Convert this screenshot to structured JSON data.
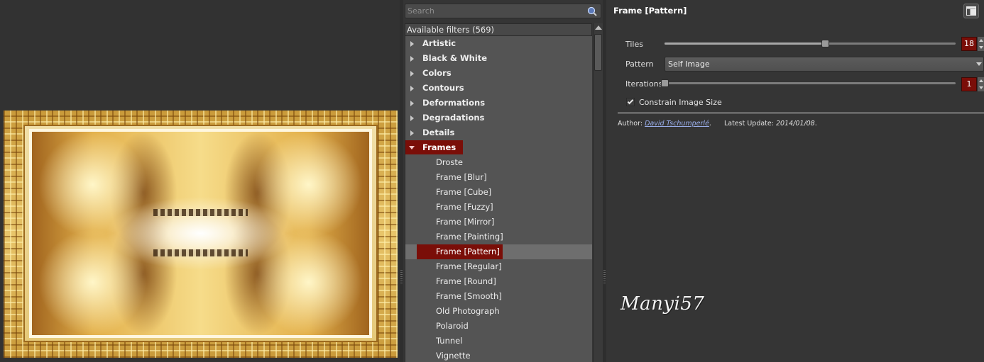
{
  "search": {
    "placeholder": "Search"
  },
  "filters": {
    "header": "Available filters (569)",
    "categories_before": [
      {
        "label": "Artistic"
      },
      {
        "label": "Black & White"
      },
      {
        "label": "Colors"
      },
      {
        "label": "Contours"
      },
      {
        "label": "Deformations"
      },
      {
        "label": "Degradations"
      },
      {
        "label": "Details"
      }
    ],
    "open_category": {
      "label": "Frames"
    },
    "sub_items": [
      {
        "label": "Droste"
      },
      {
        "label": "Frame [Blur]"
      },
      {
        "label": "Frame [Cube]"
      },
      {
        "label": "Frame [Fuzzy]"
      },
      {
        "label": "Frame [Mirror]"
      },
      {
        "label": "Frame [Painting]"
      },
      {
        "label": "Frame [Pattern]"
      },
      {
        "label": "Frame [Regular]"
      },
      {
        "label": "Frame [Round]"
      },
      {
        "label": "Frame [Smooth]"
      },
      {
        "label": "Old Photograph"
      },
      {
        "label": "Polaroid"
      },
      {
        "label": "Tunnel"
      },
      {
        "label": "Vignette"
      }
    ],
    "selected_item": "Frame [Pattern]"
  },
  "settings": {
    "title": "Frame [Pattern]",
    "tiles": {
      "label": "Tiles",
      "value": "18",
      "fraction": 0.55
    },
    "pattern": {
      "label": "Pattern",
      "value": "Self Image"
    },
    "iterations": {
      "label": "Iterations",
      "value": "1",
      "fraction": 0.0
    },
    "constrain": {
      "label": "Constrain Image Size",
      "checked": true
    },
    "author_prefix": "Author:",
    "author_name": "David Tschumperlé",
    "author_suffix": ".",
    "update_prefix": "Latest Update:",
    "update_date": "2014/01/08",
    "update_suffix": "."
  },
  "watermark": "Manyi57",
  "colors": {
    "accent": "#7a0e08",
    "panel": "#353535",
    "list": "#545454"
  },
  "icons": {
    "search": "magnifier-icon",
    "dock": "dock-window-icon"
  }
}
